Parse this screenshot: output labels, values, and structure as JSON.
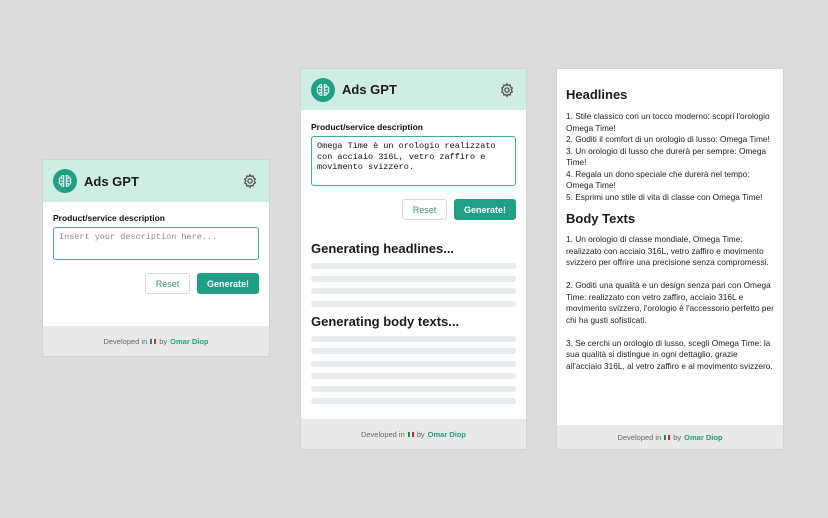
{
  "app": {
    "title": "Ads GPT",
    "logo_icon": "brain-icon",
    "settings_icon": "gear-icon",
    "accent_color": "#1f9f83",
    "header_color": "#cfeee3"
  },
  "form": {
    "label": "Product/service description",
    "placeholder": "Insert your description here...",
    "filled_value": "Omega Time è un orologio realizzato con acciaio 316L, vetro zaffiro e movimento svizzero.",
    "reset_label": "Reset",
    "generate_label": "Generate!"
  },
  "loading": {
    "headlines_title": "Generating headlines...",
    "body_title": "Generating body texts..."
  },
  "results": {
    "headlines_title": "Headlines",
    "headlines": [
      "1. Stile classico con un tocco moderno: scopri l'orologio Omega Time!",
      "2. Goditi il comfort di un orologio di lusso: Omega Time!",
      "3. Un orologio di lusso che durerà per sempre: Omega Time!",
      "4. Regala un dono speciale che durerà nel tempo: Omega Time!",
      "5. Esprimi uno stile di vita di classe con Omega Time!"
    ],
    "body_title": "Body Texts",
    "bodies": [
      "1. Un orologio di classe mondiale, Omega Time: realizzato con acciaio 316L, vetro zaffiro e movimento svizzero per offrire una precisione senza compromessi.",
      "2. Goditi una qualità e un design senza pari con Omega Time: realizzato con vetro zaffiro, acciaio 316L e movimento svizzero, l'orologio è l'accessorio perfetto per chi ha gusti sofisticati.",
      "3. Se cerchi un orologio di lusso, scegli Omega Time: la sua qualità si distingue in ogni dettaglio, grazie all'acciaio 316L, al vetro zaffiro e al movimento svizzero."
    ]
  },
  "footer": {
    "prefix": "Developed in",
    "by": "by",
    "author": "Omar Diop",
    "flag_icon": "italy-flag-icon"
  }
}
